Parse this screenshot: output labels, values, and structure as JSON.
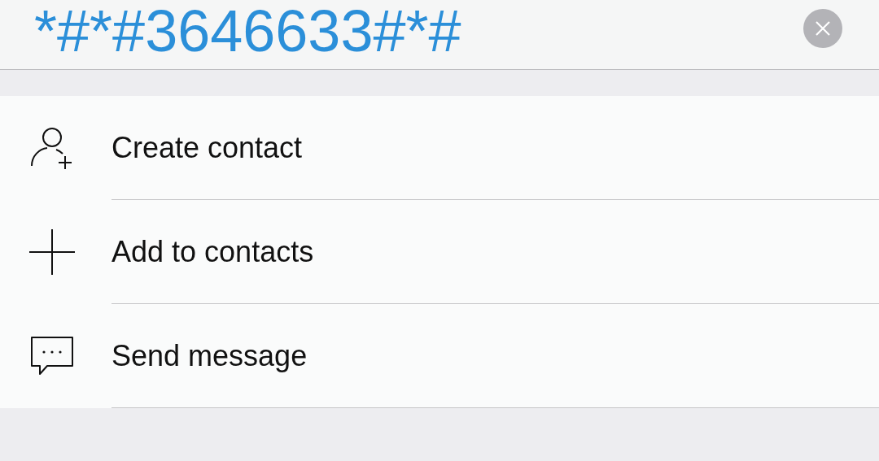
{
  "dialed_number": "*#*#3646633#*#",
  "actions": [
    {
      "kind": "create",
      "label": "Create contact"
    },
    {
      "kind": "add",
      "label": "Add to contacts"
    },
    {
      "kind": "message",
      "label": "Send message"
    }
  ]
}
